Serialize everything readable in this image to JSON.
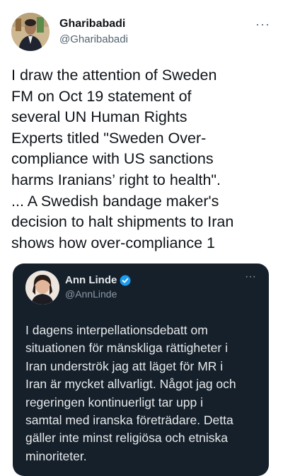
{
  "tweet": {
    "display_name": "Gharibabadi",
    "handle": "@Gharibabadi",
    "more_icon": "···",
    "text": "I draw the attention of Sweden\nFM on Oct 19 statement of\nseveral UN Human Rights\nExperts titled \"Sweden Over-\ncompliance with US sanctions\nharms Iranians’ right to health\".\n... A Swedish bandage maker's\ndecision to halt shipments to Iran\nshows how over-compliance 1"
  },
  "quoted_tweet": {
    "display_name": "Ann Linde",
    "handle": "@AnnLinde",
    "verified": true,
    "more_icon": "···",
    "text": "I dagens interpellationsdebatt om\nsituationen för mänskliga rättigheter i\nIran underströk jag att läget för MR i\nIran är mycket allvarligt. Något jag och\nregeringen kontinuerligt tar upp i\nsamtal med iranska företrädare. Detta\ngäller inte minst religiösa och etniska\nminoriteter."
  },
  "colors": {
    "background": "#ffffff",
    "quote_background": "#15202b",
    "verified_blue": "#1d9bf0",
    "secondary_text": "#536471"
  }
}
